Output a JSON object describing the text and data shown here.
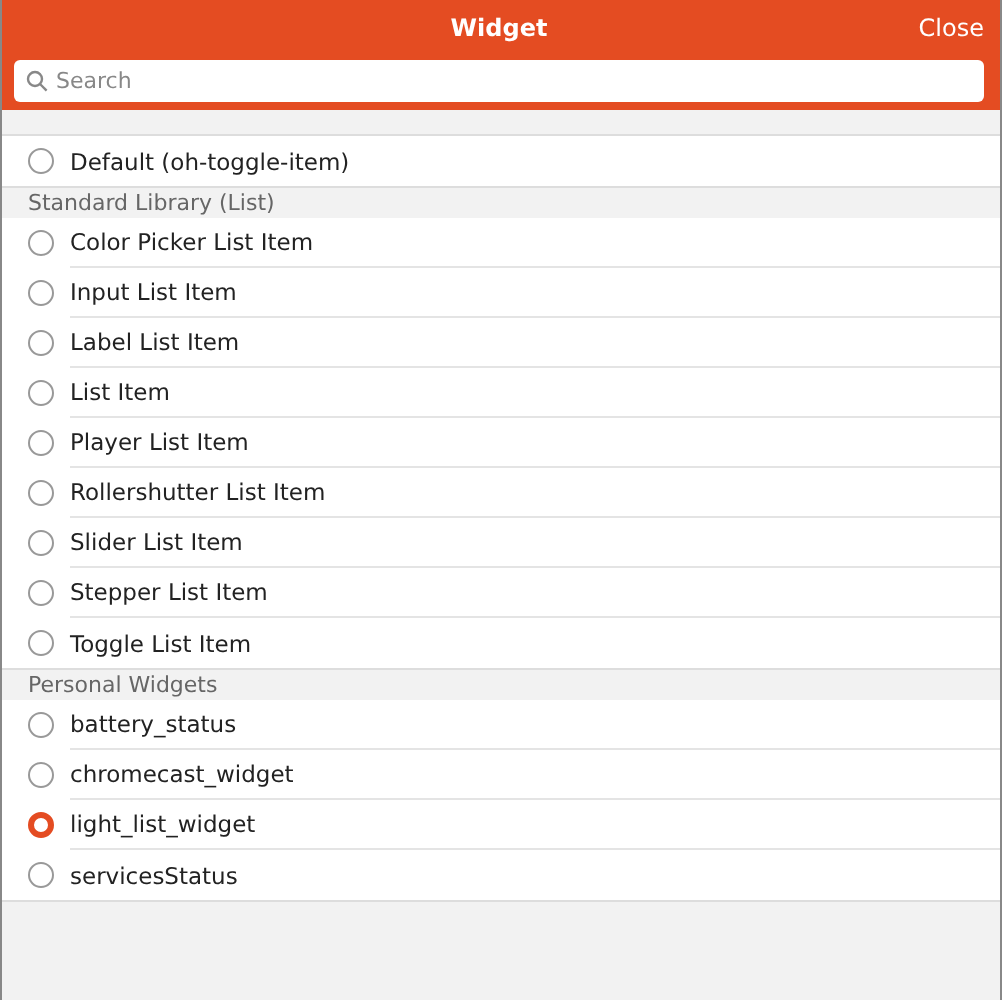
{
  "header": {
    "title": "Widget",
    "close": "Close"
  },
  "search": {
    "placeholder": "Search"
  },
  "groups": [
    {
      "items": [
        {
          "label": "Default (oh-toggle-item)",
          "selected": false
        }
      ]
    },
    {
      "title": "Standard Library (List)",
      "items": [
        {
          "label": "Color Picker List Item",
          "selected": false
        },
        {
          "label": "Input List Item",
          "selected": false
        },
        {
          "label": "Label List Item",
          "selected": false
        },
        {
          "label": "List Item",
          "selected": false
        },
        {
          "label": "Player List Item",
          "selected": false
        },
        {
          "label": "Rollershutter List Item",
          "selected": false
        },
        {
          "label": "Slider List Item",
          "selected": false
        },
        {
          "label": "Stepper List Item",
          "selected": false
        },
        {
          "label": "Toggle List Item",
          "selected": false
        }
      ]
    },
    {
      "title": "Personal Widgets",
      "items": [
        {
          "label": "battery_status",
          "selected": false
        },
        {
          "label": "chromecast_widget",
          "selected": false
        },
        {
          "label": "light_list_widget",
          "selected": true
        },
        {
          "label": "servicesStatus",
          "selected": false
        }
      ]
    }
  ]
}
